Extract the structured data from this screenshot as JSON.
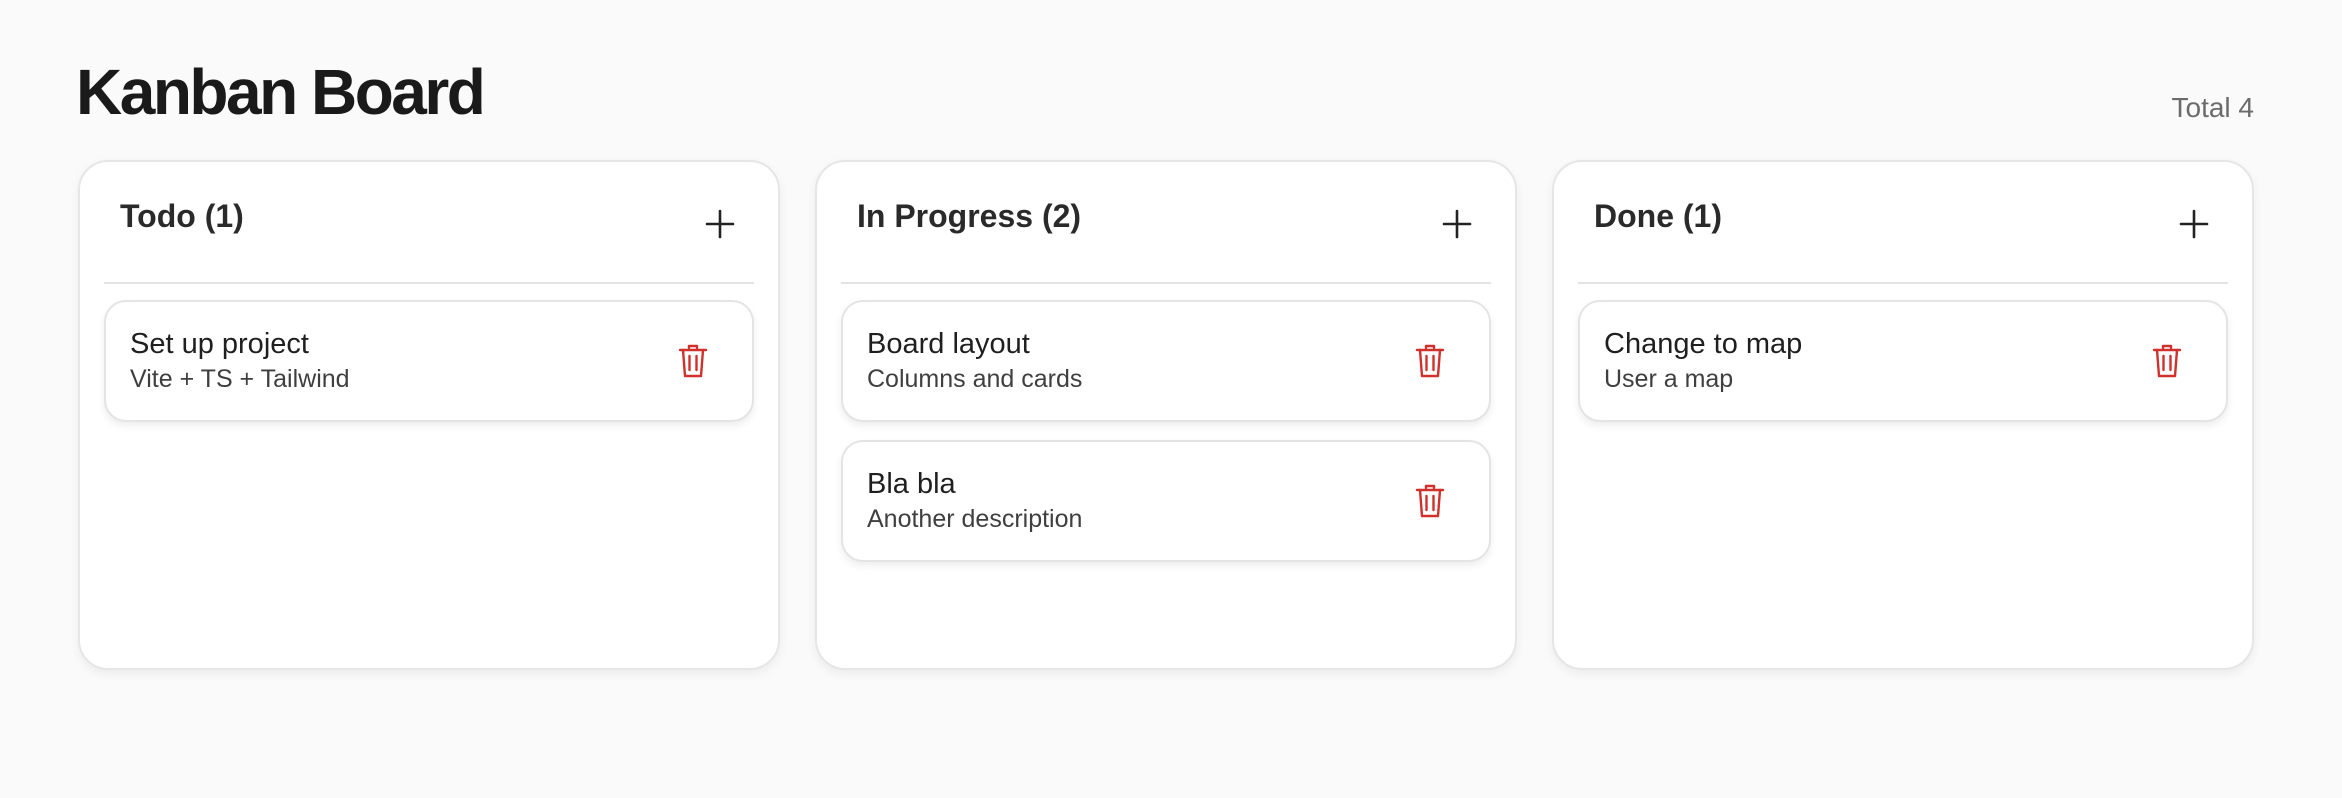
{
  "header": {
    "title": "Kanban Board",
    "total": "Total 4"
  },
  "colors": {
    "accent_delete": "#d0312d",
    "background": "#fafafa"
  },
  "columns": [
    {
      "title": "Todo (1)",
      "add_icon": "plus-icon",
      "cards": [
        {
          "title": "Set up project",
          "description": "Vite + TS + Tailwind",
          "delete_icon": "trash-icon"
        }
      ]
    },
    {
      "title": "In Progress (2)",
      "add_icon": "plus-icon",
      "cards": [
        {
          "title": "Board layout",
          "description": "Columns and cards",
          "delete_icon": "trash-icon"
        },
        {
          "title": "Bla bla",
          "description": "Another description",
          "delete_icon": "trash-icon"
        }
      ]
    },
    {
      "title": "Done (1)",
      "add_icon": "plus-icon",
      "cards": [
        {
          "title": "Change to map",
          "description": "User a map",
          "delete_icon": "trash-icon"
        }
      ]
    }
  ]
}
